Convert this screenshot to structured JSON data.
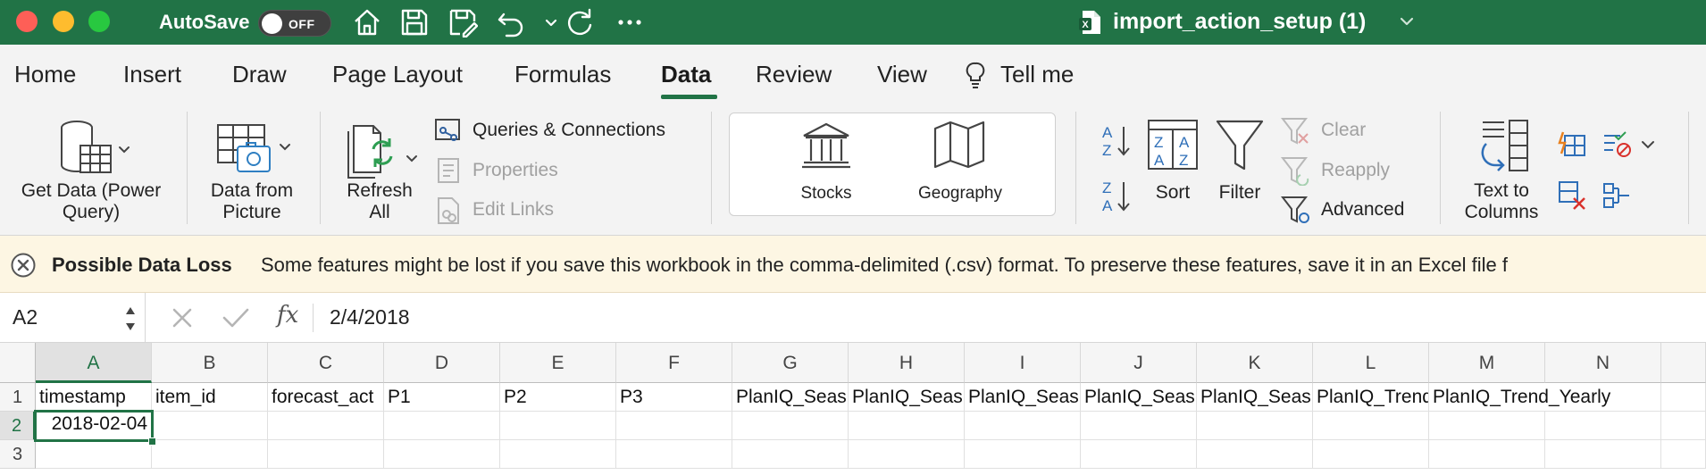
{
  "titlebar": {
    "autosave_label": "AutoSave",
    "autosave_state": "OFF",
    "doc_title": "import_action_setup (1)",
    "icons": [
      "home-icon",
      "save-icon",
      "save-as-icon",
      "undo-icon",
      "undo-dropdown-icon",
      "redo-icon",
      "more-icon"
    ]
  },
  "tabs": {
    "items": [
      "Home",
      "Insert",
      "Draw",
      "Page Layout",
      "Formulas",
      "Data",
      "Review",
      "View"
    ],
    "active": "Data",
    "tell_me": "Tell me"
  },
  "ribbon": {
    "get_data": "Get Data (Power Query)",
    "data_from_picture": "Data from Picture",
    "refresh_all": "Refresh All",
    "queries_connections": "Queries & Connections",
    "properties": "Properties",
    "edit_links": "Edit Links",
    "stocks": "Stocks",
    "geography": "Geography",
    "sort": "Sort",
    "filter": "Filter",
    "clear": "Clear",
    "reapply": "Reapply",
    "advanced": "Advanced",
    "text_to_columns": "Text to Columns"
  },
  "message": {
    "title": "Possible Data Loss",
    "text": "Some features might be lost if you save this workbook in the comma-delimited (.csv) format. To preserve these features, save it in an Excel file f"
  },
  "formula_bar": {
    "name_box": "A2",
    "fx": "fx",
    "value": "2/4/2018"
  },
  "grid": {
    "columns": [
      "A",
      "B",
      "C",
      "D",
      "E",
      "F",
      "G",
      "H",
      "I",
      "J",
      "K",
      "L",
      "M",
      "N"
    ],
    "selected_column": "A",
    "rows": [
      "1",
      "2",
      "3"
    ],
    "selected_row": "2",
    "header_row": [
      "timestamp",
      "item_id",
      "forecast_act",
      "P1",
      "P2",
      "P3",
      "PlanIQ_Seas",
      "PlanIQ_Seas",
      "PlanIQ_Seas",
      "PlanIQ_Seas",
      "PlanIQ_Seas",
      "PlanIQ_Trend",
      "PlanIQ_Trend_Yearly",
      ""
    ],
    "row2_a": "2018-02-04",
    "active_cell": "A2"
  },
  "colors": {
    "brand_green": "#217346",
    "message_bg": "#fdf6e3"
  }
}
